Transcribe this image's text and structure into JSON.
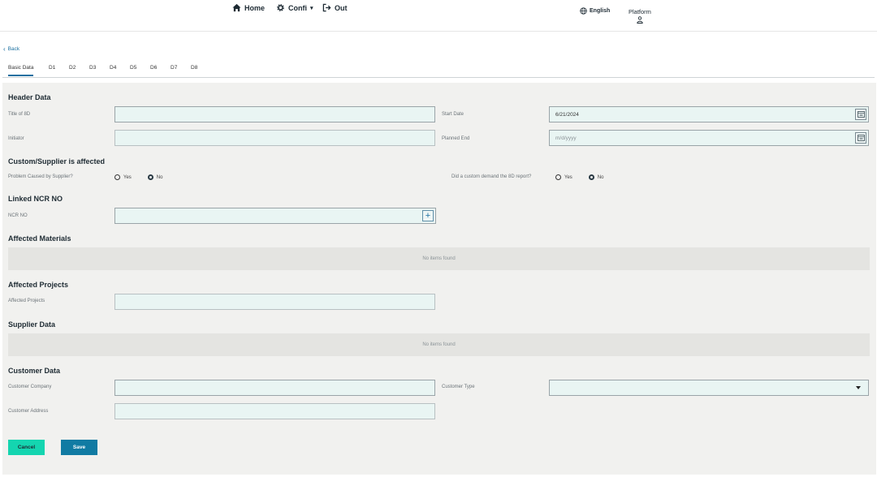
{
  "nav": {
    "home_label": "Home",
    "config_label": "Confi",
    "out_label": "Out",
    "language_label": "English",
    "platform_label": "Platform"
  },
  "back_label": "Back",
  "tabs": [
    {
      "label": "Basic Data",
      "active": true
    },
    {
      "label": "D1"
    },
    {
      "label": "D2"
    },
    {
      "label": "D3"
    },
    {
      "label": "D4"
    },
    {
      "label": "D5"
    },
    {
      "label": "D6"
    },
    {
      "label": "D7"
    },
    {
      "label": "D8"
    }
  ],
  "header_data": {
    "title": "Header Data",
    "title_of_8d_label": "Title of 8D",
    "title_of_8d_value": "",
    "start_date_label": "Start Date",
    "start_date_value": "6/21/2024",
    "initiator_label": "Initiator",
    "initiator_value": "",
    "planned_end_label": "Planned End",
    "planned_end_placeholder": "m/d/yyyy"
  },
  "supplier_affected": {
    "title": "Custom/Supplier is affected",
    "problem_label": "Problem Caused by Supplier?",
    "custom_demand_label": "Did a custom demand the 8D report?",
    "yes_label": "Yes",
    "no_label": "No",
    "problem_selected": "No",
    "custom_demand_selected": "No"
  },
  "linked_ncr": {
    "title": "Linked NCR NO",
    "ncr_label": "NCR NO",
    "ncr_value": ""
  },
  "affected_materials": {
    "title": "Affected Materials",
    "empty_text": "No items found"
  },
  "affected_projects": {
    "title": "Affected Projects",
    "field_label": "Affected Projects",
    "field_value": ""
  },
  "supplier_data": {
    "title": "Supplier Data",
    "empty_text": "No items found"
  },
  "customer_data": {
    "title": "Customer Data",
    "company_label": "Customer Company",
    "company_value": "",
    "type_label": "Customer Type",
    "type_value": "",
    "address_label": "Customer Address",
    "address_value": ""
  },
  "actions": {
    "cancel_label": "Cancel",
    "save_label": "Save"
  },
  "colors": {
    "accent_blue": "#117ba3",
    "cancel_green": "#14d5b0",
    "field_bg": "#e9f5f3",
    "panel_bg": "#f1f1ef"
  }
}
